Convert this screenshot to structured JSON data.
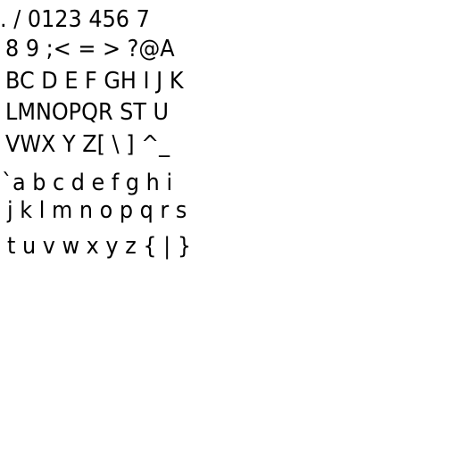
{
  "glyph_lines": [
    ". / 0123 456 7",
    "8 9 ;< = > ?@A",
    "BC D E F GH I J K",
    "LMNOPQR ST U",
    "VWX Y Z[ \\ ] ^_",
    "`a b c d e f g h i",
    "j k l m n o p q r s",
    "t u v w x y z { | }"
  ],
  "text_color": "#000000",
  "background_color": "#ffffff"
}
